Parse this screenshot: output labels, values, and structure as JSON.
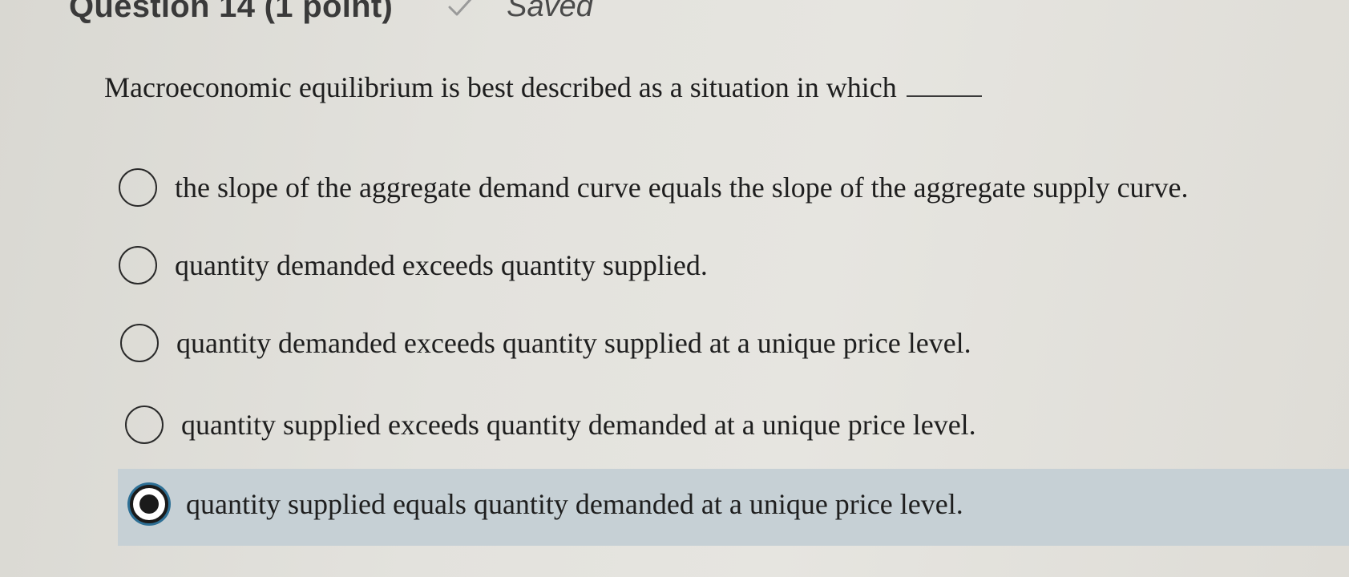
{
  "header": {
    "question_title": "Question 14 (1 point)",
    "status_icon": "checkmark-icon",
    "status_text": "Saved"
  },
  "question": {
    "text": "Macroeconomic equilibrium is best described as a situation in which"
  },
  "options": [
    {
      "label": "the slope of the aggregate demand curve equals the slope of the aggregate supply curve.",
      "selected": false
    },
    {
      "label": "quantity demanded exceeds quantity supplied.",
      "selected": false
    },
    {
      "label": "quantity demanded exceeds quantity supplied at a unique price level.",
      "selected": false
    },
    {
      "label": "quantity supplied exceeds quantity demanded at a unique price level.",
      "selected": false
    },
    {
      "label": "quantity supplied equals quantity demanded at a unique price level.",
      "selected": true
    }
  ],
  "colors": {
    "selected_band": "#c6d0d5",
    "focus_ring": "#2d6f95"
  }
}
